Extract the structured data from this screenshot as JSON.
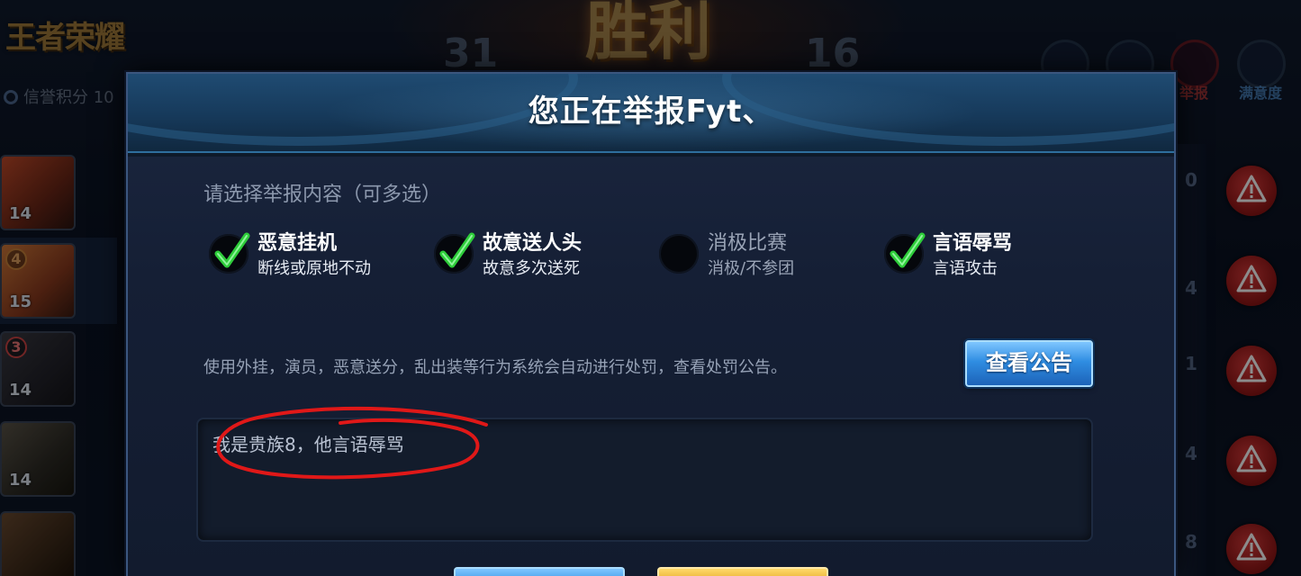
{
  "background": {
    "logo_text": "王者荣耀",
    "credit_label": "信誉积分 10",
    "score_left": "31",
    "score_right": "16",
    "result_text": "胜利",
    "top_right_buttons": [
      {
        "icon": "plus-icon",
        "label": ""
      },
      {
        "icon": "thumbs-up-icon",
        "label": ""
      },
      {
        "icon": "warning-icon",
        "label": "举报"
      },
      {
        "icon": "smile-icon",
        "label": "满意度"
      }
    ],
    "players": [
      {
        "level": "14",
        "rank": ""
      },
      {
        "level": "15",
        "rank": "4"
      },
      {
        "level": "14",
        "rank": "3"
      },
      {
        "level": "14",
        "rank": ""
      },
      {
        "level": "",
        "rank": ""
      }
    ],
    "right_strip_numbers": [
      "0",
      "4",
      "1",
      "4",
      "8"
    ],
    "report_buttons_count": 5,
    "colors": {
      "report_red": "#d83a3a"
    }
  },
  "dialog": {
    "title": "您正在举报Fyt、",
    "prompt": "请选择举报内容（可多选）",
    "options": [
      {
        "title": "恶意挂机",
        "desc": "断线或原地不动",
        "checked": true
      },
      {
        "title": "故意送人头",
        "desc": "故意多次送死",
        "checked": true
      },
      {
        "title": "消极比赛",
        "desc": "消极/不参团",
        "checked": false
      },
      {
        "title": "言语辱骂",
        "desc": "言语攻击",
        "checked": true
      }
    ],
    "notice": "使用外挂，演员，恶意送分，乱出装等行为系统会自动进行处罚，查看处罚公告。",
    "notice_button": "查看公告",
    "comment_value": "我是贵族8，他言语辱骂",
    "colors": {
      "check_green": "#2ecc3a",
      "button_blue": "#2f8de2",
      "annotation_red": "#e01818"
    }
  }
}
